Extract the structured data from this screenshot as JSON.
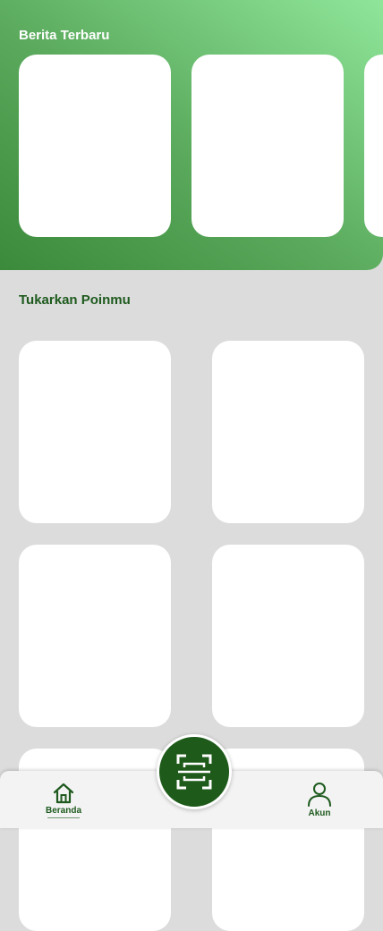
{
  "news": {
    "title": "Berita Terbaru",
    "cards": [
      "news-card-1",
      "news-card-2",
      "news-card-3"
    ]
  },
  "rewards": {
    "title": "Tukarkan Poinmu",
    "cards": [
      "reward-card-1",
      "reward-card-2",
      "reward-card-3",
      "reward-card-4",
      "reward-card-5",
      "reward-card-6"
    ]
  },
  "bottom_nav": {
    "home_label": "Beranda",
    "home_icon": "home-icon",
    "scan_icon": "scan-icon",
    "account_label": "Akun",
    "account_icon": "user-icon"
  },
  "colors": {
    "primary_green": "#1e5a1a",
    "gradient_start": "#3b8a3b",
    "gradient_end": "#8fe69a",
    "background": "#dcdcdc",
    "card": "#ffffff"
  }
}
